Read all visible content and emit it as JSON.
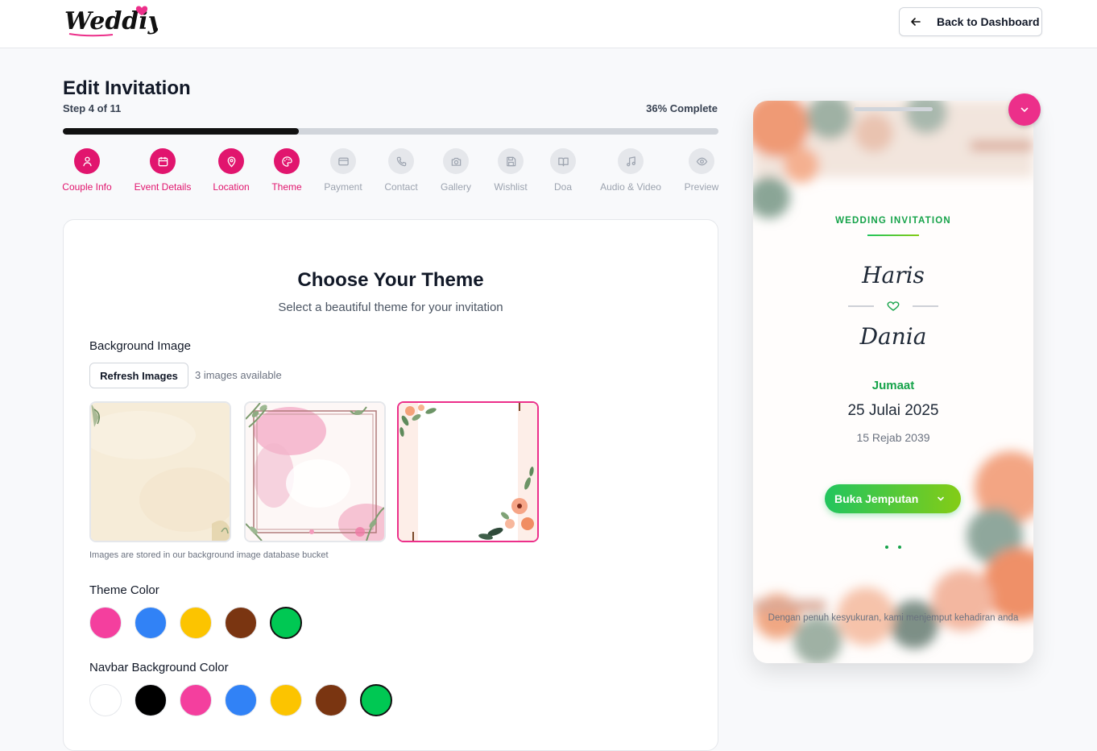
{
  "header": {
    "logo_text": "Weddiy",
    "back_label": "Back to Dashboard"
  },
  "editor": {
    "title": "Edit Invitation",
    "step_text": "Step 4 of 11",
    "percent_text": "36% Complete",
    "progress": 0.36
  },
  "steps": [
    {
      "label": "Couple Info",
      "icon": "user-icon",
      "active": true
    },
    {
      "label": "Event Details",
      "icon": "calendar-icon",
      "active": true
    },
    {
      "label": "Location",
      "icon": "map-pin-icon",
      "active": true
    },
    {
      "label": "Theme",
      "icon": "palette-icon",
      "active": true
    },
    {
      "label": "Payment",
      "icon": "credit-card-icon",
      "active": false
    },
    {
      "label": "Contact",
      "icon": "phone-icon",
      "active": false
    },
    {
      "label": "Gallery",
      "icon": "camera-icon",
      "active": false
    },
    {
      "label": "Wishlist",
      "icon": "save-icon",
      "active": false
    },
    {
      "label": "Doa",
      "icon": "book-icon",
      "active": false
    },
    {
      "label": "Audio & Video",
      "icon": "music-icon",
      "active": false
    },
    {
      "label": "Preview",
      "icon": "eye-icon",
      "active": false
    }
  ],
  "theme_card": {
    "title": "Choose Your Theme",
    "subtitle": "Select a beautiful theme for your invitation",
    "background_label": "Background Image",
    "refresh_label": "Refresh Images",
    "available_text": "3 images available",
    "bucket_note": "Images are stored in our background image database bucket",
    "theme_color_label": "Theme Color",
    "navbar_color_label": "Navbar Background Color",
    "theme_colors": [
      "#f43f9e",
      "#3182f6",
      "#fcc400",
      "#7a3511",
      "#00c853"
    ],
    "theme_color_selected": 4,
    "navbar_colors": [
      "#ffffff",
      "#000000",
      "#f43f9e",
      "#3182f6",
      "#fcc400",
      "#7a3511",
      "#00c853"
    ],
    "navbar_color_selected": 6,
    "selected_image": 2
  },
  "preview": {
    "eyebrow": "WEDDING INVITATION",
    "groom": "Haris",
    "bride": "Dania",
    "day": "Jumaat",
    "date": "25 Julai 2025",
    "hijri": "15 Rejab 2039",
    "open_button": "Buka Jemputan",
    "message": "Dengan penuh kesyukuran, kami menjemput kehadiran anda",
    "accent_color": "#16a34a"
  }
}
